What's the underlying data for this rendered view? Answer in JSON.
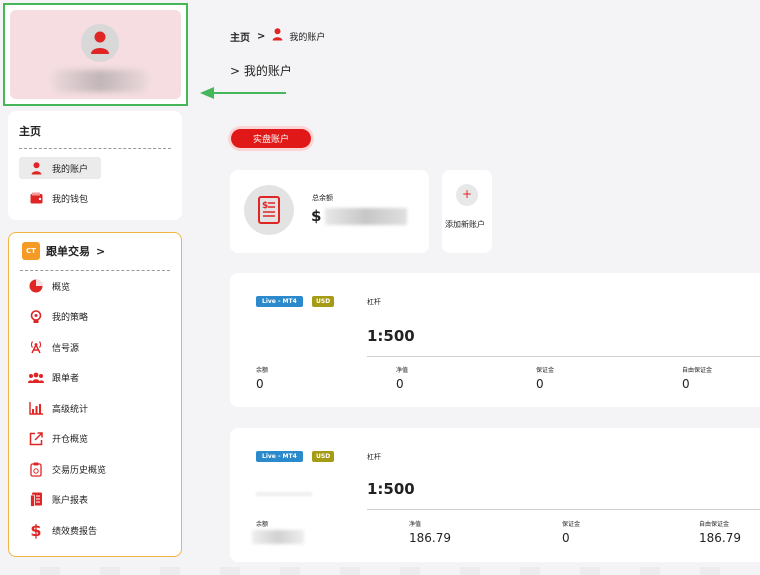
{
  "sidebar": {
    "home_title": "主页",
    "home_items": [
      {
        "label": "我的账户",
        "icon": "user-icon"
      },
      {
        "label": "我的钱包",
        "icon": "wallet-icon"
      }
    ],
    "copy_logo": "CT",
    "copy_title": "跟单交易",
    "copy_chevron": ">",
    "copy_items": [
      {
        "label": "概览",
        "icon": "pie-chart-icon"
      },
      {
        "label": "我的策略",
        "icon": "lightbulb-icon"
      },
      {
        "label": "信号源",
        "icon": "signal-tower-icon"
      },
      {
        "label": "跟单者",
        "icon": "group-icon"
      },
      {
        "label": "高级统计",
        "icon": "bar-chart-icon"
      },
      {
        "label": "开仓概览",
        "icon": "external-link-icon"
      },
      {
        "label": "交易历史概览",
        "icon": "history-icon"
      },
      {
        "label": "账户报表",
        "icon": "report-icon"
      },
      {
        "label": "绩效费报告",
        "icon": "dollar-icon"
      }
    ]
  },
  "breadcrumb": {
    "home": "主页",
    "sep": ">",
    "current": "我的账户"
  },
  "subtitle": "> 我的账户",
  "tab_real": "实盘账户",
  "balance": {
    "label": "总余额",
    "currency": "$"
  },
  "add_account": {
    "icon": "+",
    "label": "添加新账户"
  },
  "accounts": [
    {
      "badge_type": "Live - MT4",
      "badge_currency": "USD",
      "leverage_label": "杠杆",
      "leverage": "1:500",
      "metrics": [
        {
          "label": "余额",
          "value": "0"
        },
        {
          "label": "净值",
          "value": "0"
        },
        {
          "label": "保证金",
          "value": "0"
        },
        {
          "label": "自由保证金",
          "value": "0"
        }
      ]
    },
    {
      "badge_type": "Live - MT4",
      "badge_currency": "USD",
      "leverage_label": "杠杆",
      "leverage": "1:500",
      "metrics": [
        {
          "label": "余额",
          "value": ""
        },
        {
          "label": "净值",
          "value": "186.79"
        },
        {
          "label": "保证金",
          "value": "0"
        },
        {
          "label": "自由保证金",
          "value": "186.79"
        }
      ]
    }
  ],
  "colors": {
    "accent": "#e01818",
    "highlight_border": "#45b65a",
    "copy_border": "#f2b542",
    "live_badge": "#2b8acb",
    "usd_badge": "#a59b14"
  }
}
